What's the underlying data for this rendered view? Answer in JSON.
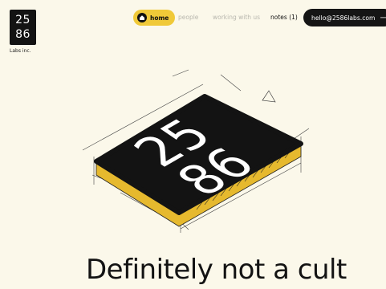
{
  "logo": {
    "top": "25",
    "bottom": "86",
    "sub": "Labs inc."
  },
  "nav": {
    "home": "home",
    "people": "people",
    "working": "working with us",
    "notes": "notes (1)"
  },
  "contact": {
    "email": "hello@2586labs.com",
    "arrow": "⟶"
  },
  "hero": {
    "top_digits": "25",
    "bottom_digits": "86"
  },
  "headline": "Definitely not a cult",
  "colors": {
    "accent": "#f0c938",
    "dark": "#151515",
    "background": "#fbf8ea"
  }
}
